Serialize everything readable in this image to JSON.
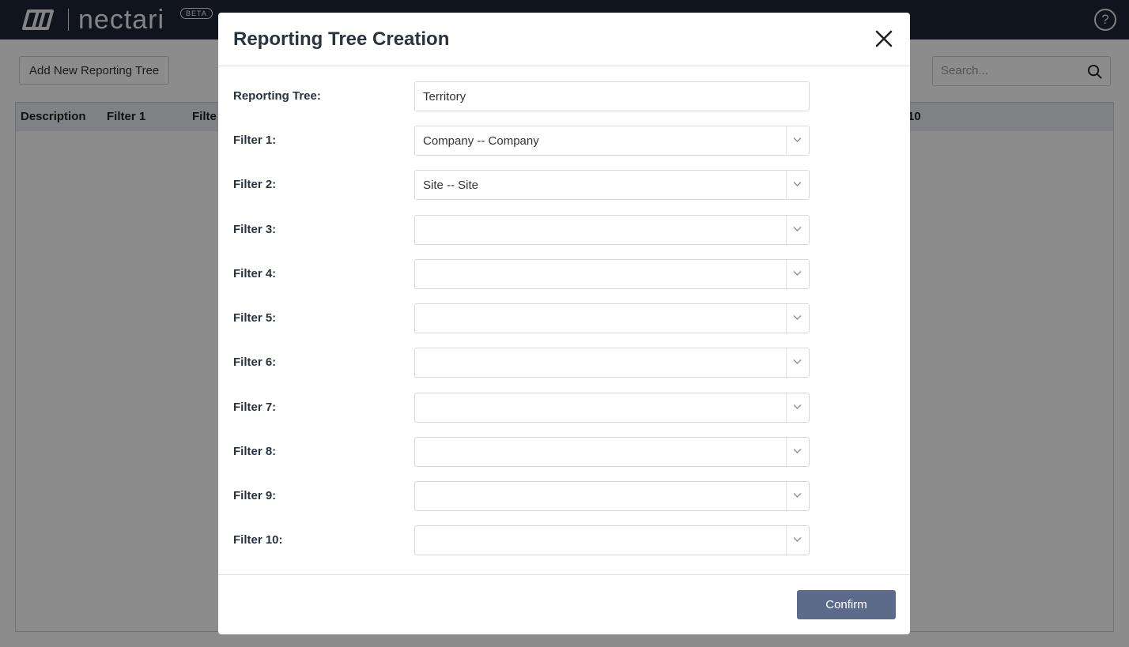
{
  "app": {
    "logo_text": "nectari",
    "badge": "BETA",
    "help_glyph": "?"
  },
  "toolbar": {
    "add_button": "Add New Reporting Tree",
    "search_placeholder": "Search..."
  },
  "table": {
    "headers": [
      "Description",
      "Filter 1",
      "Filte",
      "10"
    ]
  },
  "modal": {
    "title": "Reporting Tree Creation",
    "reporting_tree_label": "Reporting Tree:",
    "reporting_tree_value": "Territory",
    "filters": [
      {
        "label": "Filter 1:",
        "value": "Company -- Company"
      },
      {
        "label": "Filter 2:",
        "value": "Site -- Site"
      },
      {
        "label": "Filter 3:",
        "value": ""
      },
      {
        "label": "Filter 4:",
        "value": ""
      },
      {
        "label": "Filter 5:",
        "value": ""
      },
      {
        "label": "Filter 6:",
        "value": ""
      },
      {
        "label": "Filter 7:",
        "value": ""
      },
      {
        "label": "Filter 8:",
        "value": ""
      },
      {
        "label": "Filter 9:",
        "value": ""
      },
      {
        "label": "Filter 10:",
        "value": ""
      }
    ],
    "confirm_button": "Confirm"
  },
  "colors": {
    "topbar": "#1c2536",
    "confirm": "#5c6b8a",
    "table_header": "#e8ebf0"
  }
}
